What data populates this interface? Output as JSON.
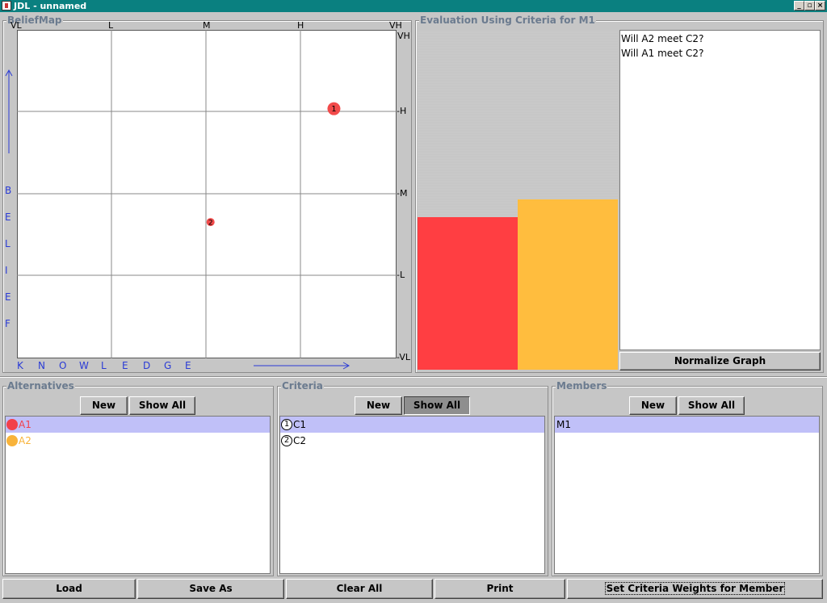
{
  "window": {
    "title": "JDL - unnamed",
    "controls": [
      "_",
      "▫",
      "×"
    ]
  },
  "beliefmap": {
    "title": "BeliefMap",
    "top_labels": [
      "VL",
      "L",
      "M",
      "H",
      "VH"
    ],
    "right_labels": [
      "VH",
      "-H",
      "-M",
      "-L",
      "-VL"
    ],
    "belief_letters": [
      "B",
      "E",
      "L",
      "I",
      "E",
      "F"
    ],
    "knowledge_letters": [
      "K",
      "N",
      "O",
      "W",
      "L",
      "E",
      "D",
      "G",
      "E"
    ],
    "points": [
      {
        "label": "1",
        "color": "#f24a4a",
        "knowledge": 0.835,
        "belief": 0.76
      },
      {
        "label": "2",
        "color": "#f24a4a",
        "knowledge": 0.51,
        "belief": 0.415
      }
    ]
  },
  "evaluation": {
    "title": "Evaluation Using Criteria for M1",
    "bars": [
      {
        "color": "#ff3e42",
        "level": 0.45
      },
      {
        "color": "#ffbd3e",
        "level": 0.5
      }
    ],
    "questions": [
      "Will A2 meet C2?",
      "Will A1 meet C2?"
    ],
    "normalize_label": "Normalize Graph"
  },
  "alternatives": {
    "title": "Alternatives",
    "new_label": "New",
    "show_all_label": "Show All",
    "items": [
      {
        "label": "A1",
        "color": "#f2404a",
        "selected": true
      },
      {
        "label": "A2",
        "color": "#f8b33a",
        "selected": false
      }
    ]
  },
  "criteria": {
    "title": "Criteria",
    "new_label": "New",
    "show_all_label": "Show All",
    "items": [
      {
        "number": "1",
        "label": "C1",
        "selected": true
      },
      {
        "number": "2",
        "label": "C2",
        "selected": false
      }
    ]
  },
  "members": {
    "title": "Members",
    "new_label": "New",
    "show_all_label": "Show All",
    "items": [
      {
        "label": "M1",
        "selected": true
      }
    ]
  },
  "bottom_buttons": {
    "load": "Load",
    "save_as": "Save As",
    "clear_all": "Clear All",
    "print": "Print",
    "set_weights": "Set Criteria Weights for Member"
  }
}
